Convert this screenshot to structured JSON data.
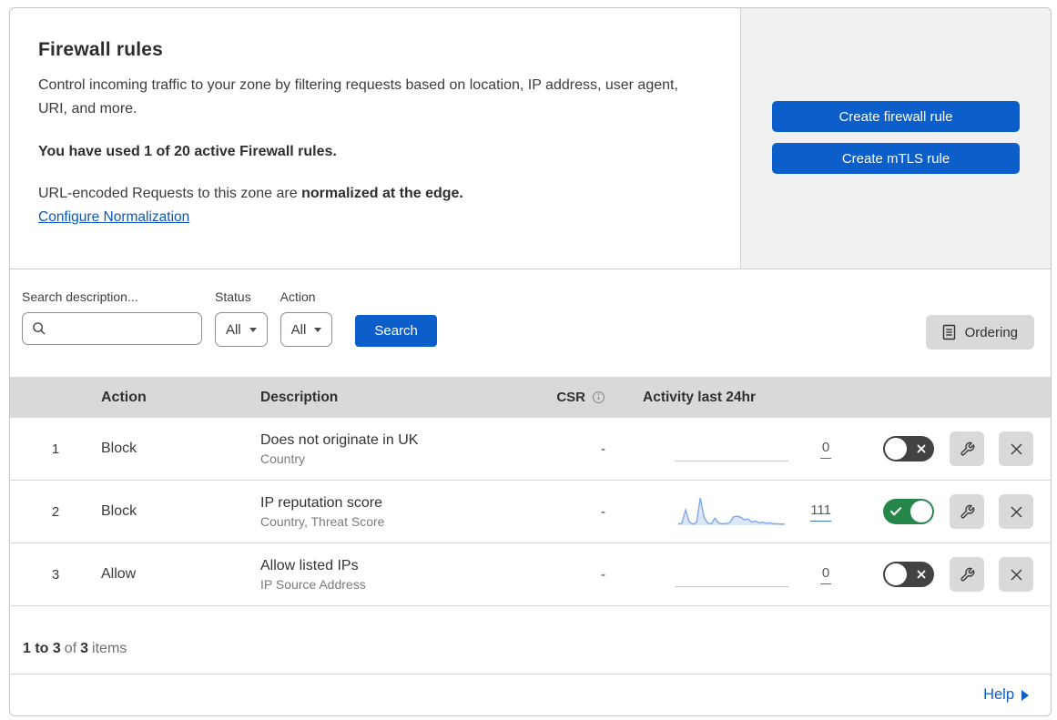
{
  "header": {
    "title": "Firewall rules",
    "description": "Control incoming traffic to your zone by filtering requests based on location, IP address, user agent, URI, and more.",
    "usage": "You have used 1 of 20 active Firewall rules.",
    "normalization_prefix": "URL-encoded Requests to this zone are ",
    "normalization_bold": "normalized at the edge.",
    "normalization_link": "Configure Normalization",
    "create_firewall_button": "Create firewall rule",
    "create_mtls_button": "Create mTLS rule"
  },
  "filters": {
    "search_label": "Search description...",
    "status_label": "Status",
    "status_value": "All",
    "action_label": "Action",
    "action_value": "All",
    "search_button": "Search",
    "ordering_button": "Ordering"
  },
  "table": {
    "columns": {
      "action": "Action",
      "description": "Description",
      "csr": "CSR",
      "activity": "Activity last 24hr"
    },
    "rows": [
      {
        "priority": "1",
        "action": "Block",
        "description": "Does not originate in UK",
        "criteria": "Country",
        "csr": "-",
        "activity_count": "0",
        "enabled": false
      },
      {
        "priority": "2",
        "action": "Block",
        "description": "IP reputation score",
        "criteria": "Country, Threat Score",
        "csr": "-",
        "activity_count": "111",
        "enabled": true
      },
      {
        "priority": "3",
        "action": "Allow",
        "description": "Allow listed IPs",
        "criteria": "IP Source Address",
        "csr": "-",
        "activity_count": "0",
        "enabled": false
      }
    ]
  },
  "chart_data": [
    {
      "type": "line",
      "title": "Activity last 24hr — rule 1 (Does not originate in UK)",
      "x_range": "last 24 hours",
      "values": [
        0,
        0,
        0,
        0,
        0,
        0,
        0,
        0,
        0,
        0,
        0,
        0,
        0,
        0,
        0,
        0,
        0,
        0,
        0,
        0,
        0,
        0,
        0,
        0
      ],
      "total": 0,
      "line_color": "#c9c9c9",
      "fill": false
    },
    {
      "type": "line",
      "title": "Activity last 24hr — rule 2 (IP reputation score)",
      "x_range": "last 24 hours",
      "values": [
        4,
        8,
        56,
        12,
        4,
        10,
        100,
        30,
        8,
        5,
        26,
        8,
        5,
        6,
        9,
        30,
        33,
        29,
        20,
        23,
        12,
        15,
        9,
        11,
        7,
        9,
        5,
        5,
        4,
        4
      ],
      "total": 111,
      "line_color": "#7fa8e4",
      "fill": true,
      "fill_color": "#dbe7f8"
    },
    {
      "type": "line",
      "title": "Activity last 24hr — rule 3 (Allow listed IPs)",
      "x_range": "last 24 hours",
      "values": [
        0,
        0,
        0,
        0,
        0,
        0,
        0,
        0,
        0,
        0,
        0,
        0,
        0,
        0,
        0,
        0,
        0,
        0,
        0,
        0,
        0,
        0,
        0,
        0
      ],
      "total": 0,
      "line_color": "#c9c9c9",
      "fill": false
    }
  ],
  "footer": {
    "range": "1 to 3",
    "of": "of",
    "total": "3",
    "items": "items",
    "help": "Help"
  },
  "colors": {
    "accent_blue": "#0c5ecb",
    "link_blue": "#0a58c0",
    "toggle_on_green": "#27874b",
    "toggle_off_gray": "#424244",
    "table_header_gray": "#d9d9d9",
    "panel_gray": "#f1f1f1"
  }
}
